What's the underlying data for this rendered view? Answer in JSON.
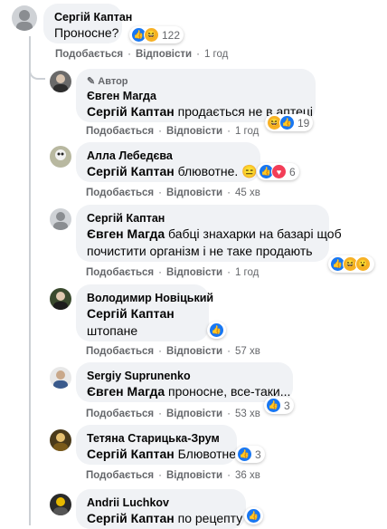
{
  "labels": {
    "like": "Подобається",
    "reply": "Відповісти",
    "author_badge": "Автор"
  },
  "comments": [
    {
      "name": "Сергій Каптан",
      "tag": "",
      "text": "Проносне?",
      "time": "1 год",
      "reactions": "122"
    },
    {
      "name": "Євген Магда",
      "tag": "Сергій Каптан",
      "text": "продається не в аптеці",
      "time": "1 год",
      "reactions": "19"
    },
    {
      "name": "Алла Лебедєва",
      "tag": "Сергій Каптан",
      "text": "блювотне. 😑",
      "time": "45 хв",
      "reactions": "6"
    },
    {
      "name": "Сергій Каптан",
      "tag": "Євген Магда",
      "text": "бабці знахарки на базарі щоб",
      "text2": "почистити організм і не таке продають",
      "time": "1 год",
      "reactions": ""
    },
    {
      "name": "Володимир Новіцький",
      "tag": "Сергій Каптан",
      "text": "штопане",
      "time": "57 хв",
      "reactions": ""
    },
    {
      "name": "Sergiy Suprunenko",
      "tag": "Євген Магда",
      "text": "проносне, все-таки...",
      "time": "53 хв",
      "reactions": "3"
    },
    {
      "name": "Тетяна Стариць­ка-Зрум",
      "tag": "Сергій Каптан",
      "text": "Блювотне.",
      "time": "36 хв",
      "reactions": "3"
    },
    {
      "name": "Andrii Luchkov",
      "tag": "Сергій Каптан",
      "text": "по рецепту",
      "time": "",
      "reactions": ""
    }
  ],
  "colors": {
    "bubble": "#f0f2f5",
    "like": "#1877f2",
    "love": "#f33e58",
    "haha": "#f7b125",
    "meta": "#65676b"
  }
}
